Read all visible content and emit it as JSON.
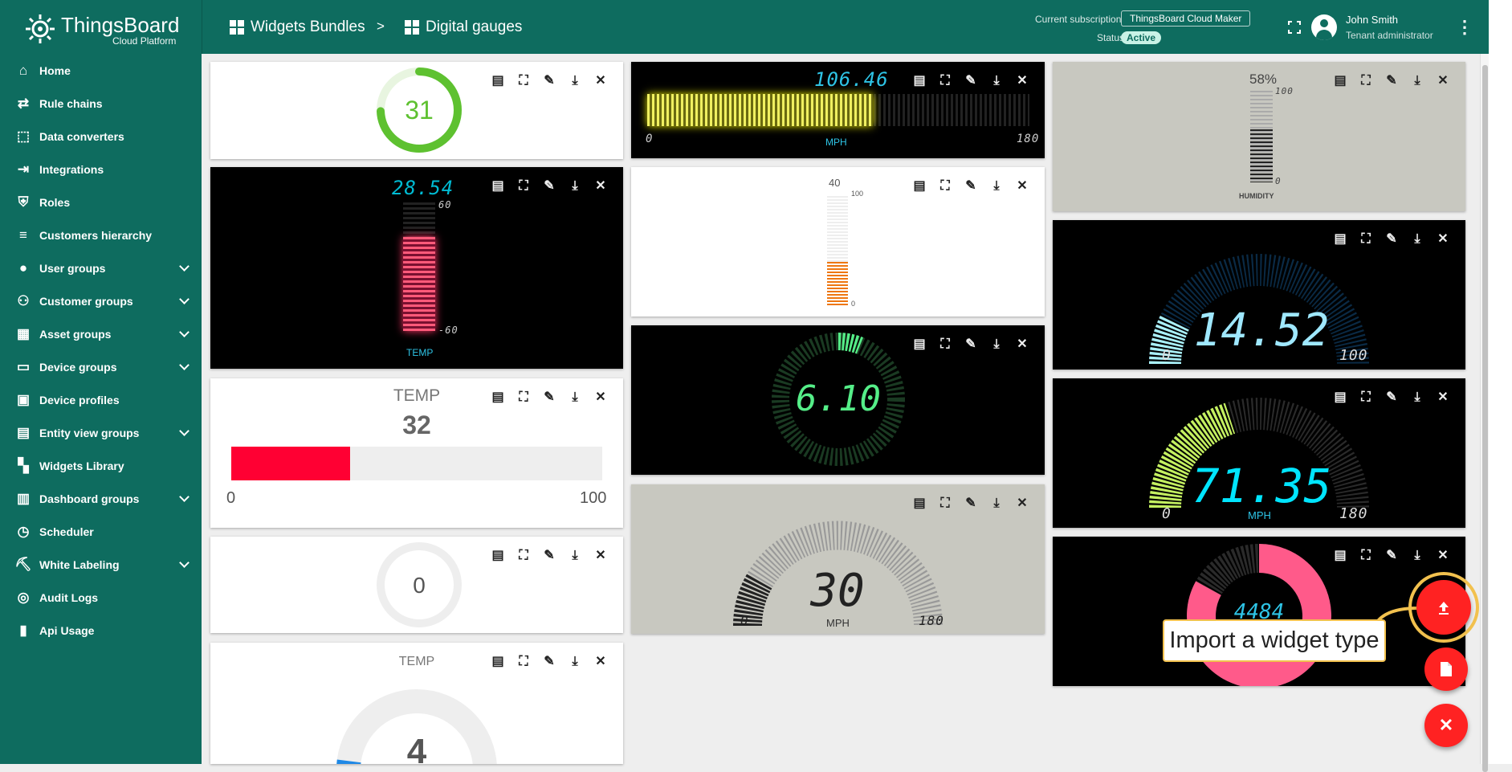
{
  "app": {
    "title": "ThingsBoard",
    "subtitle": "Cloud Platform"
  },
  "breadcrumb": {
    "parent": "Widgets Bundles",
    "separator": ">",
    "current": "Digital gauges"
  },
  "subscription": {
    "label": "Current subscription",
    "plan": "ThingsBoard Cloud Maker",
    "status_label": "Status",
    "status": "Active"
  },
  "user": {
    "name": "John Smith",
    "role": "Tenant administrator"
  },
  "sidebar": {
    "items": [
      {
        "label": "Home",
        "icon": "home-icon",
        "expandable": false
      },
      {
        "label": "Rule chains",
        "icon": "rule-chains-icon",
        "expandable": false
      },
      {
        "label": "Data converters",
        "icon": "data-converters-icon",
        "expandable": false
      },
      {
        "label": "Integrations",
        "icon": "integrations-icon",
        "expandable": false
      },
      {
        "label": "Roles",
        "icon": "roles-icon",
        "expandable": false
      },
      {
        "label": "Customers hierarchy",
        "icon": "hierarchy-icon",
        "expandable": false
      },
      {
        "label": "User groups",
        "icon": "user-groups-icon",
        "expandable": true
      },
      {
        "label": "Customer groups",
        "icon": "customer-groups-icon",
        "expandable": true
      },
      {
        "label": "Asset groups",
        "icon": "asset-groups-icon",
        "expandable": true
      },
      {
        "label": "Device groups",
        "icon": "device-groups-icon",
        "expandable": true
      },
      {
        "label": "Device profiles",
        "icon": "device-profiles-icon",
        "expandable": false
      },
      {
        "label": "Entity view groups",
        "icon": "entity-view-groups-icon",
        "expandable": true
      },
      {
        "label": "Widgets Library",
        "icon": "widgets-library-icon",
        "expandable": false
      },
      {
        "label": "Dashboard groups",
        "icon": "dashboard-groups-icon",
        "expandable": true
      },
      {
        "label": "Scheduler",
        "icon": "scheduler-icon",
        "expandable": false
      },
      {
        "label": "White Labeling",
        "icon": "white-labeling-icon",
        "expandable": true
      },
      {
        "label": "Audit Logs",
        "icon": "audit-logs-icon",
        "expandable": false
      },
      {
        "label": "Api Usage",
        "icon": "api-usage-icon",
        "expandable": false
      }
    ]
  },
  "widgets": {
    "donut_green": {
      "value": "31",
      "fraction": 0.31,
      "color": "#5ec130"
    },
    "vbar_temp": {
      "value": "28.54",
      "max": "60",
      "min": "-60",
      "label": "TEMP",
      "fraction": 0.73,
      "color": "#ff5a7a",
      "accent": "#00bcd4"
    },
    "hbar_temp": {
      "title": "TEMP",
      "value": "32",
      "min": "0",
      "max": "100",
      "fraction": 0.32,
      "color": "#ff0033"
    },
    "donut_zero": {
      "value": "0",
      "fraction": 0
    },
    "arc_temp": {
      "title": "TEMP",
      "value": "4",
      "fraction": 0.04,
      "color": "#1e88e5"
    },
    "hbar_mph": {
      "value": "106.46",
      "min": "0",
      "max": "180",
      "label": "MPH",
      "fraction": 0.59,
      "color": "#f0f060",
      "accent": "#2ec4e6"
    },
    "vbar_orange": {
      "value": "40",
      "max": "100",
      "min": "0",
      "fraction": 0.4,
      "color": "#ee7711"
    },
    "dial_green": {
      "value": "6.10",
      "fraction": 0.061,
      "color": "#55ee88"
    },
    "speedo_grey": {
      "value": "30",
      "min": "0",
      "max": "180",
      "label": "MPH",
      "fraction": 0.17
    },
    "humidity": {
      "value": "58%",
      "max": "100",
      "min": "0",
      "label": "HUMIDITY",
      "fraction": 0.58
    },
    "arc_cyan": {
      "value": "14.52",
      "min": "0",
      "max": "100",
      "fraction": 0.145,
      "color": "#aaf0f8",
      "accent": "#9fe8ff"
    },
    "arc_lime": {
      "value": "71.35",
      "min": "0",
      "max": "180",
      "label": "MPH",
      "fraction": 0.4,
      "color": "#c4f060",
      "accent": "#00e5ff"
    },
    "donut_pink": {
      "value": "4484",
      "fraction": 0.83,
      "color": "#ff5a8a",
      "accent": "#2ec4e6"
    }
  },
  "fab": {
    "tooltip": "Import a widget type",
    "import_icon": "upload-icon",
    "create_icon": "file-icon",
    "close_icon": "close-icon"
  },
  "card_controls": [
    "export-icon",
    "fullscreen-icon",
    "edit-icon",
    "download-icon",
    "close-icon"
  ]
}
